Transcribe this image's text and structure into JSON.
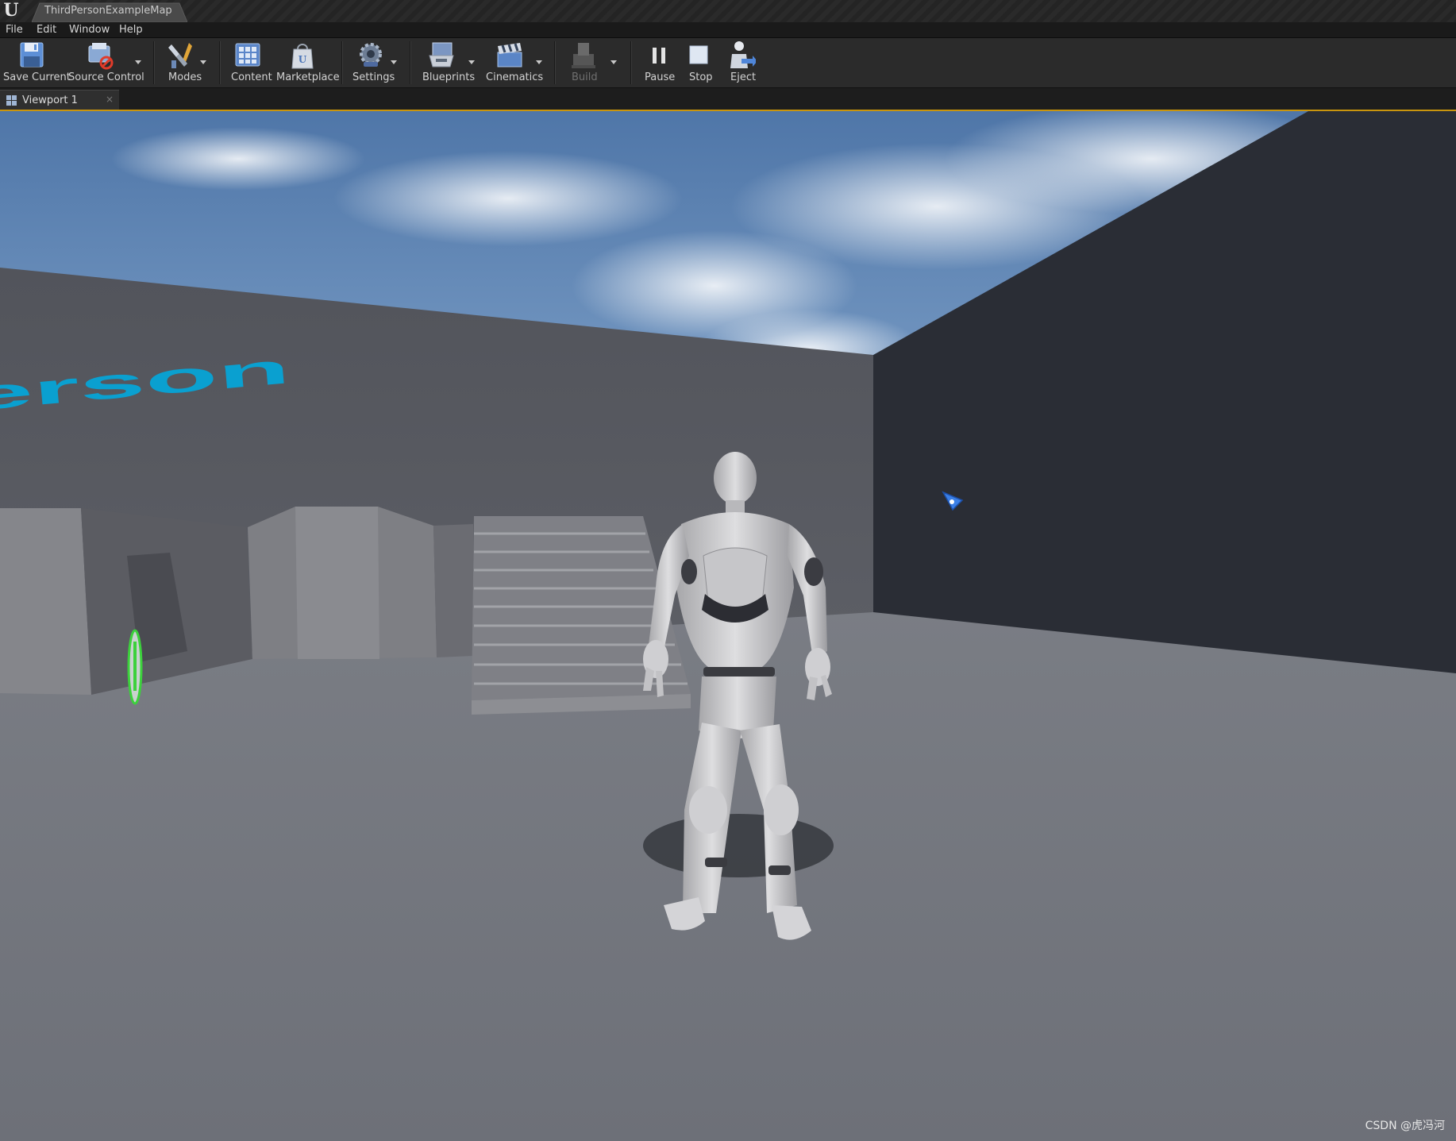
{
  "window": {
    "logo": "U",
    "tab_title": "ThirdPersonExampleMap"
  },
  "menu": {
    "items": [
      "File",
      "Edit",
      "Window",
      "Help"
    ]
  },
  "toolbar": {
    "buttons": [
      {
        "label": "Save Current",
        "icon": "floppy-disk-icon"
      },
      {
        "label": "Source Control",
        "icon": "source-control-icon"
      },
      {
        "label": "Modes",
        "icon": "modes-tools-icon"
      },
      {
        "label": "Content",
        "icon": "content-browser-icon"
      },
      {
        "label": "Marketplace",
        "icon": "marketplace-bag-icon"
      },
      {
        "label": "Settings",
        "icon": "settings-gears-icon"
      },
      {
        "label": "Blueprints",
        "icon": "blueprints-icon"
      },
      {
        "label": "Cinematics",
        "icon": "clapperboard-icon"
      },
      {
        "label": "Build",
        "icon": "build-icon",
        "disabled": true
      },
      {
        "label": "Pause",
        "icon": "pause-icon"
      },
      {
        "label": "Stop",
        "icon": "stop-icon"
      },
      {
        "label": "Eject",
        "icon": "eject-person-icon"
      }
    ]
  },
  "viewport": {
    "tab_label": "Viewport 1",
    "tab_close": "×",
    "floor_text": "erson"
  },
  "colors": {
    "accent": "#c9950e",
    "floor_text": "#0aa0d0",
    "cursor": "#3b7fe6",
    "pickup": "#3cd13c"
  },
  "watermark": "CSDN @虎冯河"
}
